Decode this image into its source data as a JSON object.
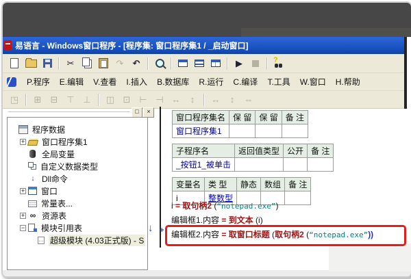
{
  "window": {
    "title": "易语言 - Windows窗口程序 - [程序集: 窗口程序集1 / _启动窗口]"
  },
  "menu": {
    "items": [
      {
        "id": "program",
        "label": "P.程序"
      },
      {
        "id": "edit",
        "label": "E.编辑"
      },
      {
        "id": "view",
        "label": "V.查看"
      },
      {
        "id": "insert",
        "label": "I.插入"
      },
      {
        "id": "database",
        "label": "B.数据库"
      },
      {
        "id": "run",
        "label": "R.运行"
      },
      {
        "id": "compile",
        "label": "C.编译"
      },
      {
        "id": "tools",
        "label": "T.工具"
      },
      {
        "id": "window",
        "label": "W.窗口"
      },
      {
        "id": "help",
        "label": "H.帮助"
      }
    ]
  },
  "toolbar_main": {
    "items": [
      {
        "type": "icon",
        "name": "new-file"
      },
      {
        "type": "icon",
        "name": "open-file"
      },
      {
        "type": "icon",
        "name": "save"
      },
      {
        "type": "sep"
      },
      {
        "type": "icon",
        "name": "cut",
        "glyph": "✂"
      },
      {
        "type": "icon",
        "name": "copy"
      },
      {
        "type": "icon",
        "name": "paste"
      },
      {
        "type": "icon",
        "name": "redo",
        "glyph": "↷",
        "disabled": true
      },
      {
        "type": "icon",
        "name": "undo",
        "glyph": "↶"
      },
      {
        "type": "sep"
      },
      {
        "type": "icon",
        "name": "find"
      },
      {
        "type": "sep"
      },
      {
        "type": "icon",
        "name": "layout-left"
      },
      {
        "type": "icon",
        "name": "layout-top"
      },
      {
        "type": "icon",
        "name": "layout-split"
      },
      {
        "type": "sep"
      },
      {
        "type": "icon",
        "name": "run",
        "glyph": "▶"
      },
      {
        "type": "icon",
        "name": "stop",
        "disabled": true
      },
      {
        "type": "sep"
      },
      {
        "type": "icon",
        "name": "help-find"
      }
    ]
  },
  "toolbar_form": {
    "items": [
      {
        "type": "icon",
        "name": "form-grid",
        "glyph": "◳",
        "disabled": true
      },
      {
        "type": "sep"
      },
      {
        "type": "icon",
        "name": "align-add-left",
        "glyph": "⊞",
        "disabled": true
      },
      {
        "type": "icon",
        "name": "align-add-right",
        "glyph": "⊟",
        "disabled": true
      },
      {
        "type": "icon",
        "name": "align-add-top",
        "glyph": "⊤",
        "disabled": true
      },
      {
        "type": "icon",
        "name": "align-add-bottom",
        "glyph": "⊥",
        "disabled": true
      },
      {
        "type": "sep"
      },
      {
        "type": "icon",
        "name": "align-center-h",
        "glyph": "◫",
        "disabled": true
      },
      {
        "type": "icon",
        "name": "align-center-v",
        "glyph": "⊡",
        "disabled": true
      },
      {
        "type": "icon",
        "name": "align-left-edge",
        "glyph": "⊢",
        "disabled": true
      },
      {
        "type": "icon",
        "name": "align-right-edge",
        "glyph": "⊣",
        "disabled": true
      },
      {
        "type": "icon",
        "name": "space-equal-h",
        "glyph": "↔",
        "disabled": true
      },
      {
        "type": "icon",
        "name": "space-equal-v",
        "glyph": "↕",
        "disabled": true
      },
      {
        "type": "sep"
      },
      {
        "type": "icon",
        "name": "same-width",
        "glyph": "↔",
        "disabled": true
      },
      {
        "type": "icon",
        "name": "same-height",
        "glyph": "↕",
        "disabled": true
      },
      {
        "type": "icon",
        "name": "same-size",
        "glyph": "⇔",
        "disabled": true
      }
    ]
  },
  "sidebar": {
    "header_buttons": [
      {
        "name": "float",
        "glyph": "□"
      },
      {
        "name": "close",
        "glyph": "×"
      }
    ],
    "tree": [
      {
        "label": "程序数据",
        "level": 0,
        "expander": "",
        "icon": "program-data"
      },
      {
        "label": "窗口程序集1",
        "level": 1,
        "expander": "+",
        "icon": "assembly"
      },
      {
        "label": "全局变量",
        "level": 1,
        "expander": "",
        "icon": "global-var"
      },
      {
        "label": "自定义数据类型",
        "level": 1,
        "expander": "",
        "icon": "data-type"
      },
      {
        "label": "Dll命令",
        "level": 1,
        "expander": "",
        "icon": "dll",
        "glyph": "↓"
      },
      {
        "label": "窗口",
        "level": 1,
        "expander": "+",
        "icon": "window"
      },
      {
        "label": "常量表...",
        "level": 1,
        "expander": "",
        "icon": "const-table"
      },
      {
        "label": "资源表",
        "level": 1,
        "expander": "+",
        "icon": "resource-table",
        "glyph": "∞"
      },
      {
        "label": "模块引用表",
        "level": 1,
        "expander": "−",
        "icon": "module-table"
      },
      {
        "label": "超级模块 (4.03正式版) - S",
        "level": 2,
        "expander": "",
        "icon": "module",
        "glyph": "…",
        "selected": true
      }
    ]
  },
  "tables": [
    {
      "name": "assembly-table",
      "headers": [
        "窗口程序集名",
        "保 留",
        "保 留",
        "备 注"
      ],
      "widths": [
        100,
        52,
        40,
        48
      ],
      "rows": [
        [
          {
            "t": "窗口程序集1",
            "c": "blue"
          },
          {
            "t": "",
            "c": ""
          },
          {
            "t": "",
            "c": ""
          },
          {
            "t": "",
            "c": ""
          }
        ]
      ]
    },
    {
      "name": "subroutine-table",
      "headers": [
        "子程序名",
        "返回值类型",
        "公开",
        "备 注"
      ],
      "widths": [
        100,
        74,
        38,
        122
      ],
      "rows": [
        [
          {
            "t": "_按钮1_被单击",
            "c": "blue"
          },
          {
            "t": "",
            "c": ""
          },
          {
            "t": "",
            "c": ""
          },
          {
            "t": "",
            "c": ""
          }
        ]
      ]
    },
    {
      "name": "variable-table",
      "headers": [
        "变量名",
        "类 型",
        "静态",
        "数组",
        "备 注"
      ],
      "widths": [
        56,
        50,
        38,
        38,
        42
      ],
      "rows": [
        [
          {
            "t": "i",
            "c": ""
          },
          {
            "t": "整数型",
            "c": "link"
          },
          {
            "t": "",
            "c": ""
          },
          {
            "t": "",
            "c": ""
          },
          {
            "t": "",
            "c": ""
          }
        ]
      ]
    }
  ],
  "code": {
    "margin_arrow": "↓",
    "fold_marker": "+",
    "lines": [
      {
        "tokens": [
          {
            "t": "i ",
            "c": "v"
          },
          {
            "t": " =  ",
            "c": "op"
          },
          {
            "t": "取句柄2",
            "c": "fn"
          },
          {
            "t": " (",
            "c": "p"
          },
          {
            "t": "“notepad.exe”",
            "c": "str"
          },
          {
            "t": ")",
            "c": "p"
          }
        ]
      },
      {
        "tokens": [
          {
            "t": "编辑框1.内容",
            "c": "v"
          },
          {
            "t": "  =  ",
            "c": "op"
          },
          {
            "t": "到文本",
            "c": "fn"
          },
          {
            "t": " (i)",
            "c": "p"
          }
        ]
      },
      {
        "tokens": [
          {
            "t": "编辑框2.内容",
            "c": "v"
          },
          {
            "t": "  =  ",
            "c": "op"
          },
          {
            "t": "取窗口标题",
            "c": "fn"
          },
          {
            "t": " (",
            "c": "p"
          },
          {
            "t": "取句柄2",
            "c": "fn"
          },
          {
            "t": " (",
            "c": "p"
          },
          {
            "t": "“notepad.exe”",
            "c": "str"
          },
          {
            "t": "))",
            "c": "pb"
          }
        ]
      }
    ]
  },
  "colors": {
    "accent_red_box": "#e61c1c",
    "titlebar_blue": "#1750bd",
    "toolbar_beige": "#ece9d8",
    "fn_color": "#a01414",
    "string_color": "#008080",
    "link_blue": "#0000c8"
  }
}
